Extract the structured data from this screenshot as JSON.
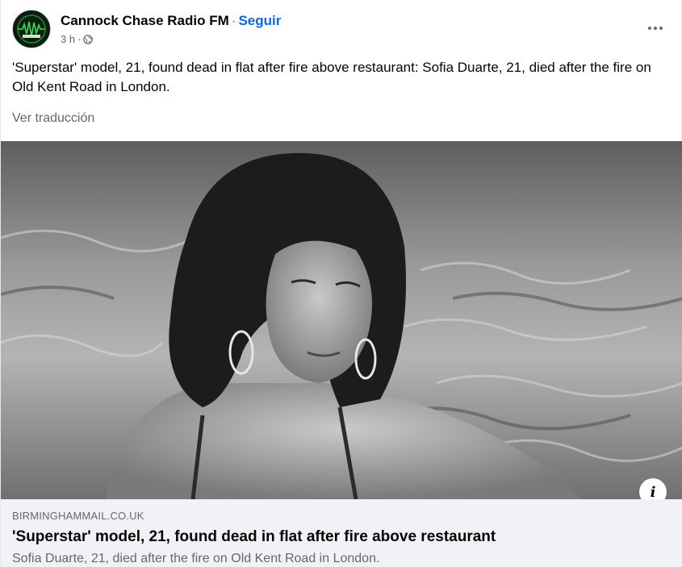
{
  "post": {
    "page_name": "Cannock Chase Radio FM",
    "separator": "·",
    "follow_label": "Seguir",
    "time": "3 h",
    "meta_separator": "·",
    "privacy_icon": "globe-icon",
    "more_icon": "more-horizontal-icon",
    "text": "'Superstar' model, 21, found dead in flat after fire above restaurant: Sofia Duarte, 21, died after the fire on Old Kent Road in London.",
    "translate_label": "Ver traducción"
  },
  "link_preview": {
    "domain": "BIRMINGHAMMAIL.CO.UK",
    "headline": "'Superstar' model, 21, found dead in flat after fire above restaurant",
    "description": "Sofia Duarte, 21, died after the fire on Old Kent Road in London.",
    "info_icon": "info-icon",
    "info_label": "i"
  },
  "colors": {
    "link_blue": "#0866ff",
    "secondary_text": "#65676b",
    "preview_bg": "#f0f2f5"
  }
}
